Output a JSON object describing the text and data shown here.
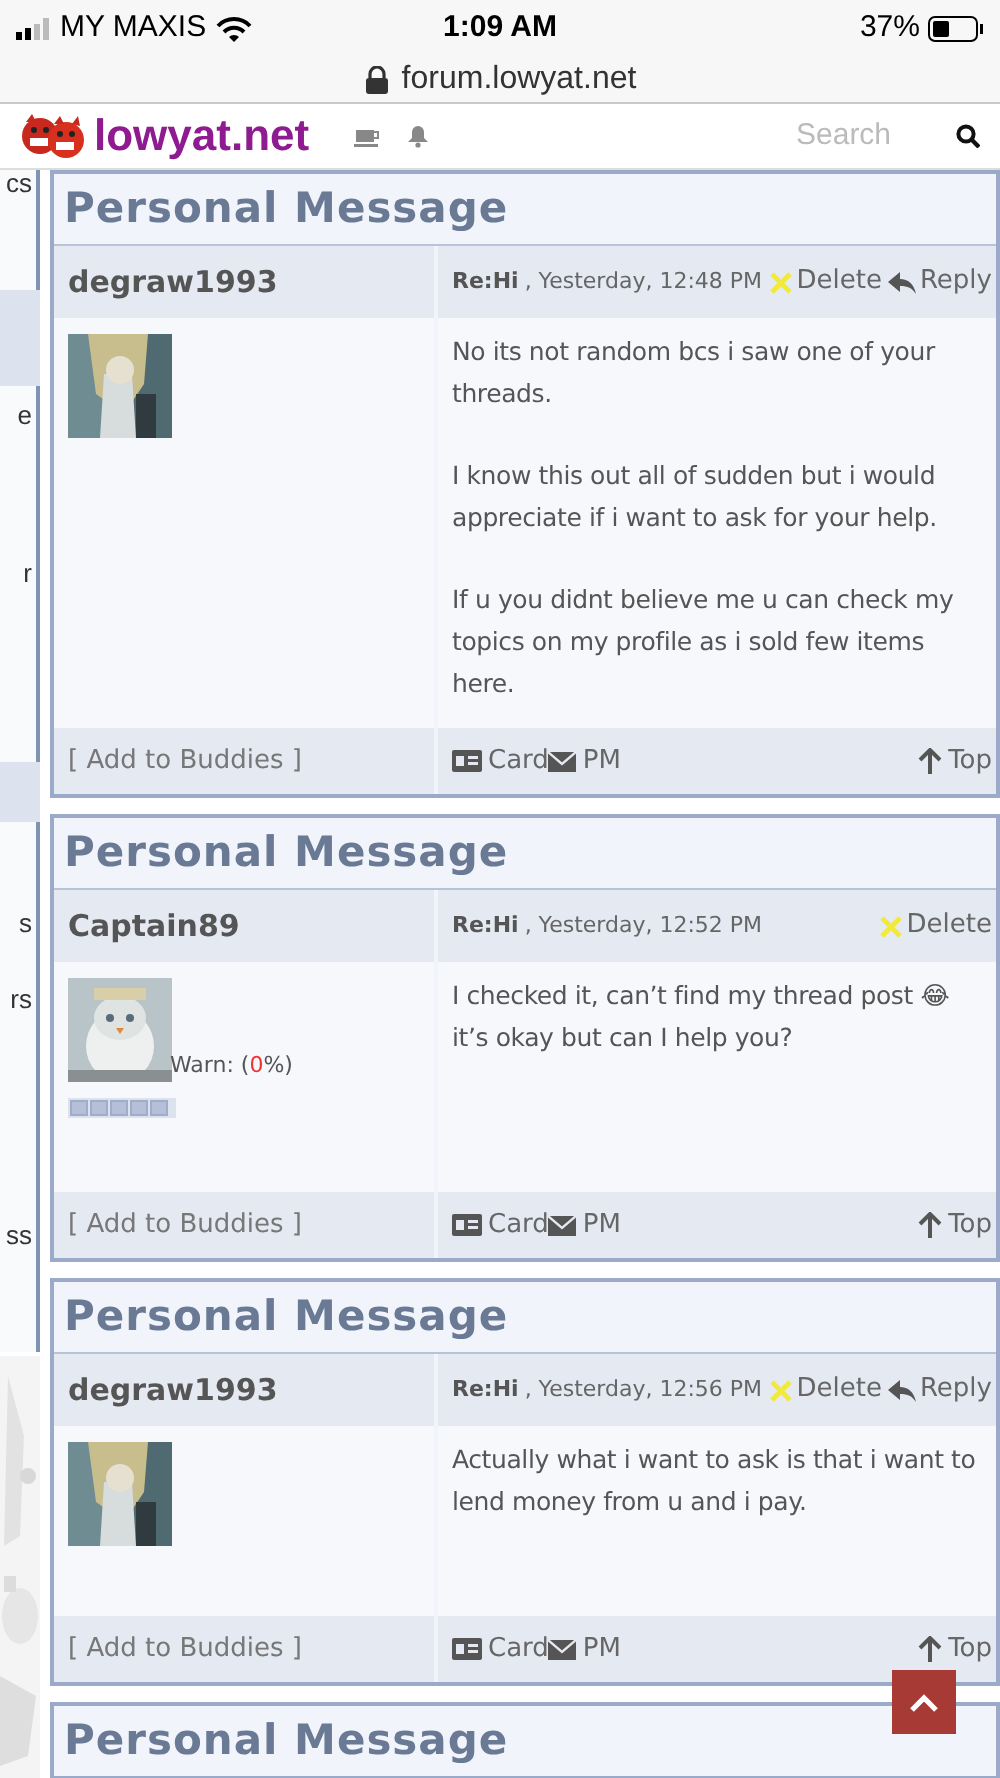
{
  "status_bar": {
    "carrier": "MY MAXIS",
    "time": "1:09 AM",
    "battery": "37%"
  },
  "url_bar": {
    "url": "forum.lowyat.net"
  },
  "nav": {
    "logo": "lowyat.net",
    "search": {
      "placeholder": "Search"
    }
  },
  "sidebar": {
    "items": [
      {
        "label": "cs"
      },
      {
        "label": "e"
      },
      {
        "label": "r"
      },
      {
        "label": "s"
      },
      {
        "label": "rs"
      },
      {
        "label": "ss"
      }
    ]
  },
  "messages": [
    {
      "title": "Personal Message",
      "author": "degraw1993",
      "subject": "Re:Hi",
      "date": ", Yesterday, 12:48 PM",
      "actions": [
        "Delete",
        "Reply"
      ],
      "body": [
        "No its not random bcs i saw one of your threads.",
        "I know this out all of sudden but i would appreciate if i want to ask for your help.",
        "If u you didnt believe me u can check my topics on my profile as i sold few items here."
      ],
      "footer": {
        "buddies": "[ Add to Buddies ]",
        "card": "Card",
        "pm": "PM",
        "top": "Top"
      }
    },
    {
      "title": "Personal Message",
      "author": "Captain89",
      "subject": "Re:Hi",
      "date": ", Yesterday, 12:52 PM",
      "actions": [
        "Delete"
      ],
      "warn": {
        "prefix": "Warn: (",
        "value": "0",
        "suffix": "%)"
      },
      "body": [
        "I checked it, can’t find my thread post 😂 it’s okay but can I help you?"
      ],
      "footer": {
        "buddies": "[ Add to Buddies ]",
        "card": "Card",
        "pm": "PM",
        "top": "Top"
      }
    },
    {
      "title": "Personal Message",
      "author": "degraw1993",
      "subject": "Re:Hi",
      "date": ", Yesterday, 12:56 PM",
      "actions": [
        "Delete",
        "Reply"
      ],
      "body": [
        "Actually what i want to ask is that i want to lend money from u and i pay."
      ],
      "footer": {
        "buddies": "[ Add to Buddies ]",
        "card": "Card",
        "pm": "PM",
        "top": "Top"
      }
    },
    {
      "title": "Personal Message"
    }
  ]
}
